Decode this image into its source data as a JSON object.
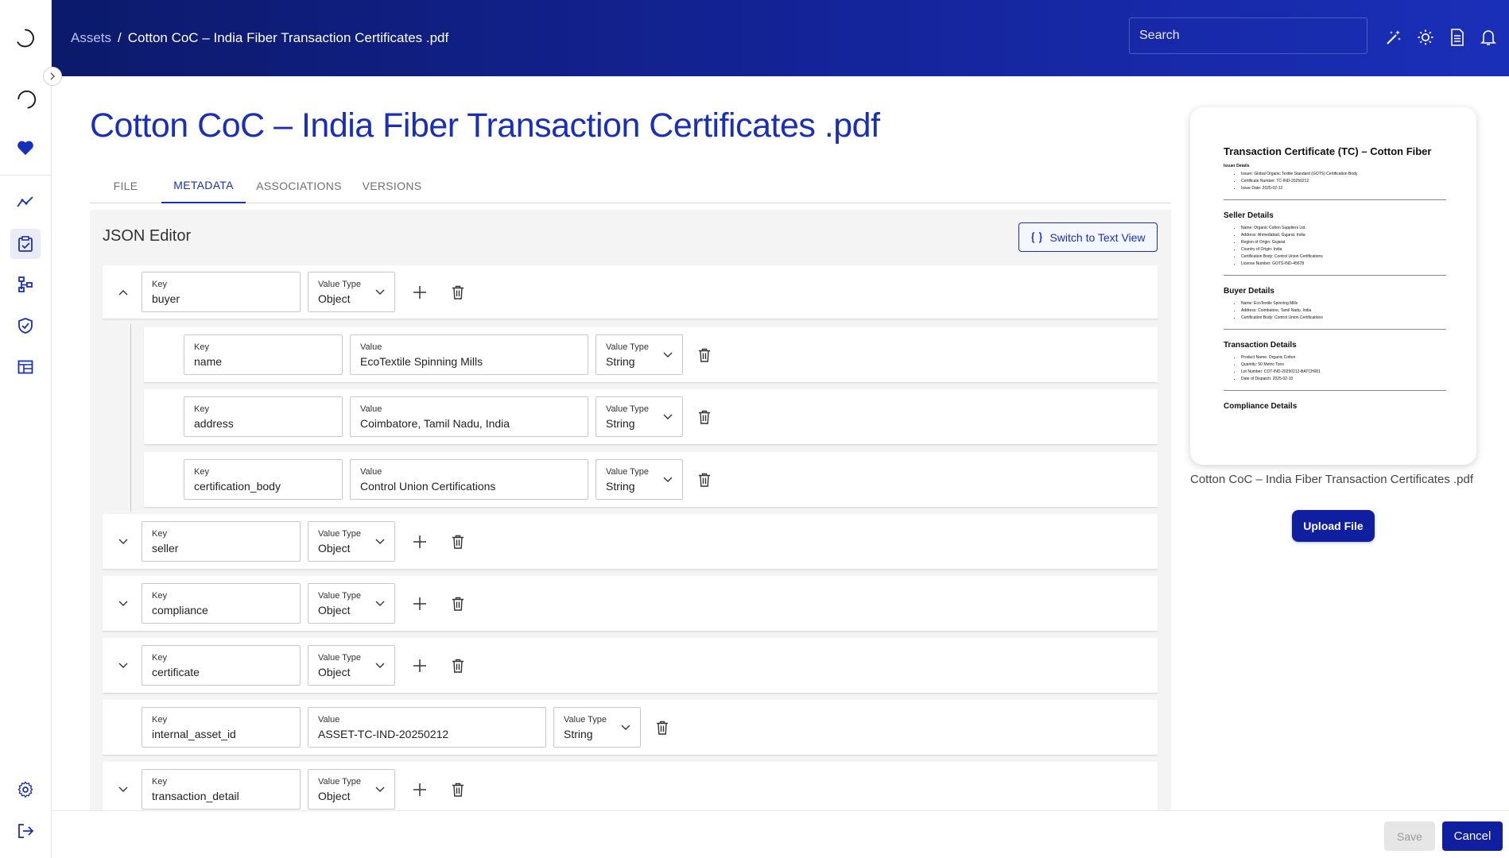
{
  "breadcrumb": {
    "root": "Assets",
    "separator": "/",
    "current": "Cotton CoC – India Fiber Transaction Certificates .pdf"
  },
  "header": {
    "search_placeholder": "Search",
    "icons": [
      "magic-wand-icon",
      "sun-icon",
      "document-icon",
      "bell-icon"
    ]
  },
  "sidebar": {
    "icons": [
      "spinner-icon",
      "spinner-icon",
      "heart-icon",
      "analytics-icon",
      "clipboard-check-icon",
      "hierarchy-icon",
      "shield-check-icon",
      "table-icon",
      "settings-icon",
      "logout-icon"
    ],
    "active": "clipboard-check-icon"
  },
  "page": {
    "title": "Cotton CoC – India Fiber Transaction Certificates .pdf"
  },
  "tabs": [
    {
      "label": "FILE",
      "active": false
    },
    {
      "label": "METADATA",
      "active": true
    },
    {
      "label": "ASSOCIATIONS",
      "active": false
    },
    {
      "label": "VERSIONS",
      "active": false
    }
  ],
  "editor": {
    "title": "JSON Editor",
    "switch_label": "Switch to Text View",
    "key_label": "Key",
    "value_label": "Value",
    "type_label": "Value Type",
    "rows": [
      {
        "key": "buyer",
        "type": "Object",
        "expanded": true,
        "children": [
          {
            "key": "name",
            "value": "EcoTextile Spinning Mills",
            "type": "String"
          },
          {
            "key": "address",
            "value": "Coimbatore, Tamil Nadu, India",
            "type": "String"
          },
          {
            "key": "certification_body",
            "value": "Control Union Certifications",
            "type": "String"
          }
        ]
      },
      {
        "key": "seller",
        "type": "Object",
        "expanded": false
      },
      {
        "key": "compliance",
        "type": "Object",
        "expanded": false
      },
      {
        "key": "certificate",
        "type": "Object",
        "expanded": false
      },
      {
        "key": "internal_asset_id",
        "value": "ASSET-TC-IND-20250212",
        "type": "String"
      },
      {
        "key": "transaction_detail",
        "type": "Object",
        "expanded": false
      }
    ]
  },
  "preview": {
    "doc_title": "Transaction Certificate (TC) – Cotton Fiber",
    "issuer_heading": "Issuer Details",
    "issuer_items": [
      "Issuer: Global Organic Textile Standard (GOTS) Certification Body",
      "Certificate Number: TC-IND-20250212",
      "Issue Date: 2025-02-12"
    ],
    "seller_heading": "Seller Details",
    "seller_items": [
      "Name: Organic Cotton Suppliers Ltd.",
      "Address: Ahmedabad, Gujarat, India",
      "Region of Origin: Gujarat",
      "Country of Origin: India",
      "Certification Body: Control Union Certifications",
      "License Number: GOTS-IND-45678"
    ],
    "buyer_heading": "Buyer Details",
    "buyer_items": [
      "Name: EcoTextile Spinning Mills",
      "Address: Coimbatore, Tamil Nadu, India",
      "Certification Body: Control Union Certifications"
    ],
    "transaction_heading": "Transaction Details",
    "transaction_items": [
      "Product Name: Organic Cotton",
      "Quantity: 50 Metric Tons",
      "Lot Number: COT-IND-20250212-BATCH001",
      "Date of Dispatch: 2025-02-10"
    ],
    "compliance_heading": "Compliance Details",
    "file_name": "Cotton CoC – India Fiber Transaction Certificates .pdf",
    "upload_label": "Upload File"
  },
  "footer": {
    "save_label": "Save",
    "cancel_label": "Cancel"
  },
  "colors": {
    "brand": "#1a2fb8",
    "header_dark": "#0c1a6b",
    "button": "#0f1fa0"
  }
}
